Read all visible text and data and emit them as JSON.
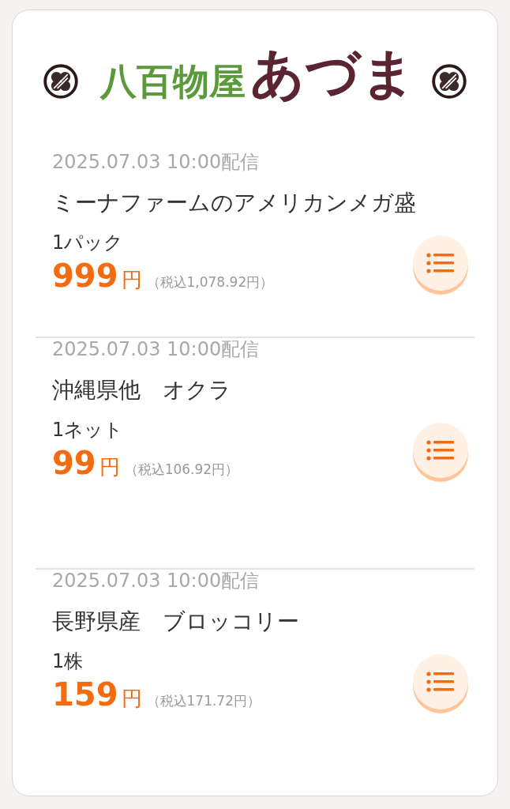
{
  "logo": {
    "green_text": "八百物屋",
    "brand_text": "あづま"
  },
  "products": [
    {
      "date": "2025.07.03 10:00配信",
      "name": "ミーナファームのアメリカンメガ盛",
      "unit": "1パック",
      "price": "999",
      "yen": "円",
      "tax_price": "（税込1,078.92円）"
    },
    {
      "date": "2025.07.03 10:00配信",
      "name": "沖縄県他　オクラ",
      "unit": "1ネット",
      "price": "99",
      "yen": "円",
      "tax_price": "（税込106.92円）"
    },
    {
      "date": "2025.07.03 10:00配信",
      "name": "長野県産　ブロッコリー",
      "unit": "1株",
      "price": "159",
      "yen": "円",
      "tax_price": "（税込171.72円）"
    }
  ]
}
